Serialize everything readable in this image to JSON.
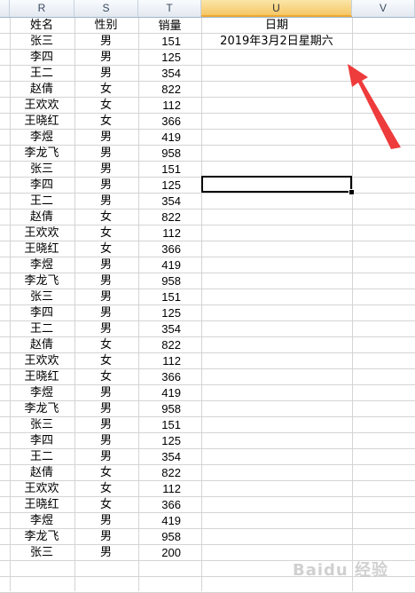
{
  "columns": [
    {
      "letter": "R"
    },
    {
      "letter": "S"
    },
    {
      "letter": "T"
    },
    {
      "letter": "U"
    },
    {
      "letter": "V"
    }
  ],
  "headers": {
    "name": "姓名",
    "sex": "性别",
    "qty": "销量",
    "date": "日期"
  },
  "date_value": "2019年3月2日星期六",
  "rows": [
    {
      "name": "张三",
      "sex": "男",
      "qty": "151"
    },
    {
      "name": "李四",
      "sex": "男",
      "qty": "125"
    },
    {
      "name": "王二",
      "sex": "男",
      "qty": "354"
    },
    {
      "name": "赵倩",
      "sex": "女",
      "qty": "822"
    },
    {
      "name": "王欢欢",
      "sex": "女",
      "qty": "112"
    },
    {
      "name": "王晓红",
      "sex": "女",
      "qty": "366"
    },
    {
      "name": "李煜",
      "sex": "男",
      "qty": "419"
    },
    {
      "name": "李龙飞",
      "sex": "男",
      "qty": "958"
    },
    {
      "name": "张三",
      "sex": "男",
      "qty": "151"
    },
    {
      "name": "李四",
      "sex": "男",
      "qty": "125"
    },
    {
      "name": "王二",
      "sex": "男",
      "qty": "354"
    },
    {
      "name": "赵倩",
      "sex": "女",
      "qty": "822"
    },
    {
      "name": "王欢欢",
      "sex": "女",
      "qty": "112"
    },
    {
      "name": "王晓红",
      "sex": "女",
      "qty": "366"
    },
    {
      "name": "李煜",
      "sex": "男",
      "qty": "419"
    },
    {
      "name": "李龙飞",
      "sex": "男",
      "qty": "958"
    },
    {
      "name": "张三",
      "sex": "男",
      "qty": "151"
    },
    {
      "name": "李四",
      "sex": "男",
      "qty": "125"
    },
    {
      "name": "王二",
      "sex": "男",
      "qty": "354"
    },
    {
      "name": "赵倩",
      "sex": "女",
      "qty": "822"
    },
    {
      "name": "王欢欢",
      "sex": "女",
      "qty": "112"
    },
    {
      "name": "王晓红",
      "sex": "女",
      "qty": "366"
    },
    {
      "name": "李煜",
      "sex": "男",
      "qty": "419"
    },
    {
      "name": "李龙飞",
      "sex": "男",
      "qty": "958"
    },
    {
      "name": "张三",
      "sex": "男",
      "qty": "151"
    },
    {
      "name": "李四",
      "sex": "男",
      "qty": "125"
    },
    {
      "name": "王二",
      "sex": "男",
      "qty": "354"
    },
    {
      "name": "赵倩",
      "sex": "女",
      "qty": "822"
    },
    {
      "name": "王欢欢",
      "sex": "女",
      "qty": "112"
    },
    {
      "name": "王晓红",
      "sex": "女",
      "qty": "366"
    },
    {
      "name": "李煜",
      "sex": "男",
      "qty": "419"
    },
    {
      "name": "李龙飞",
      "sex": "男",
      "qty": "958"
    },
    {
      "name": "张三",
      "sex": "男",
      "qty": "200"
    }
  ],
  "watermark": "Baidu 经验",
  "colors": {
    "selected_col_header": "#f5c766",
    "arrow": "#ee3b3b",
    "gridline": "#d4d4d4"
  }
}
